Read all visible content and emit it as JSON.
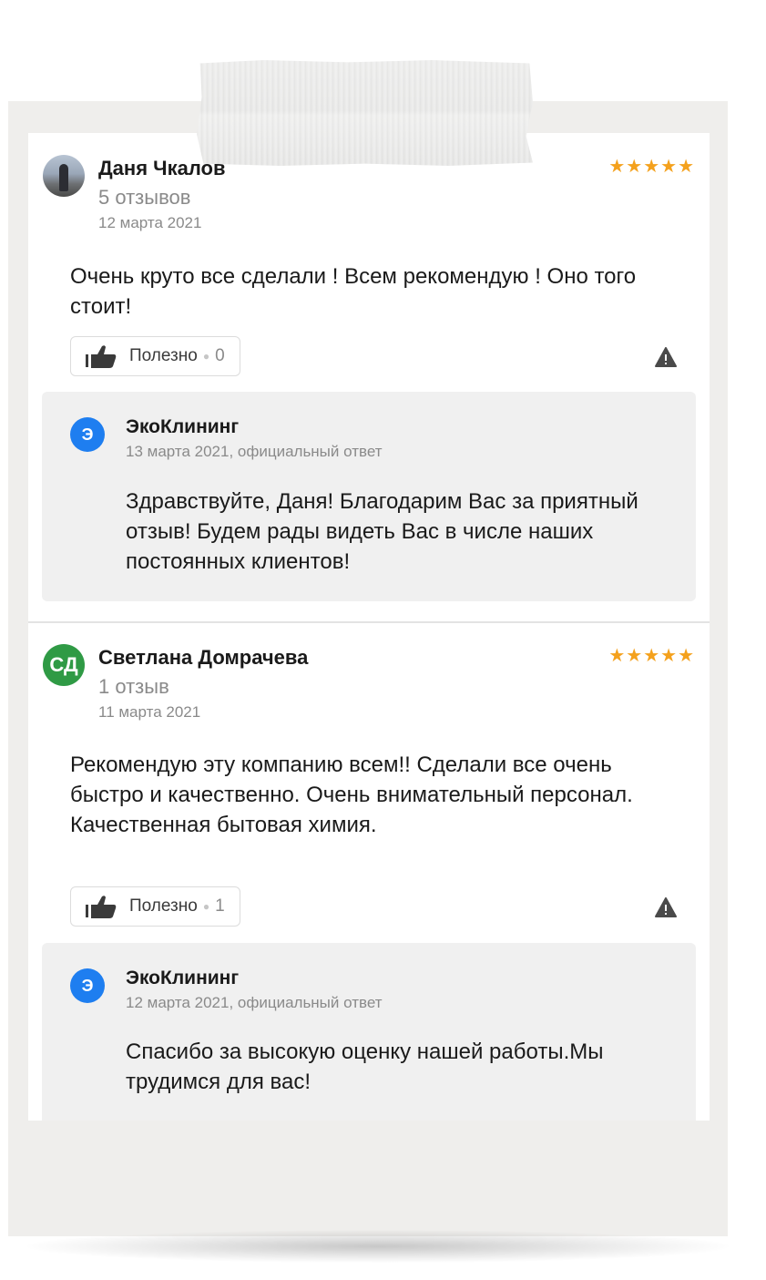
{
  "reviews": [
    {
      "author": "Даня Чкалов",
      "review_count": "5 отзывов",
      "date": "12 марта 2021",
      "rating": "★★★★★",
      "text": "Очень круто все сделали ! Всем рекомендую ! Оно того стоит!",
      "helpful_label": "Полезно",
      "helpful_count": "0",
      "reply": {
        "company": "ЭкоКлининг",
        "logo_letter": "Э",
        "date": "13 марта 2021, официальный ответ",
        "text": "Здравствуйте, Даня! Благодарим Вас за приятный отзыв! Будем рады видеть Вас в числе наших постоянных клиентов!"
      }
    },
    {
      "author": "Светлана Домрачева",
      "initials": "СД",
      "review_count": "1 отзыв",
      "date": "11 марта 2021",
      "rating": "★★★★★",
      "text": "Рекомендую эту компанию всем!! Сделали все очень быстро и качественно. Очень внимательный персонал. Качественная бытовая химия.",
      "helpful_label": "Полезно",
      "helpful_count": "1",
      "reply": {
        "company": "ЭкоКлининг",
        "logo_letter": "Э",
        "date": "12 марта 2021, официальный ответ",
        "text": "Спасибо за высокую оценку нашей работы.Мы трудимся для вас!"
      }
    }
  ],
  "colors": {
    "star": "#f4a11d",
    "company_logo": "#1e7ef0",
    "initials_avatar": "#2f9a45",
    "reply_background": "#f0f0f0"
  },
  "icons": [
    "thumbs-up-icon",
    "warning-icon",
    "star-icon"
  ]
}
